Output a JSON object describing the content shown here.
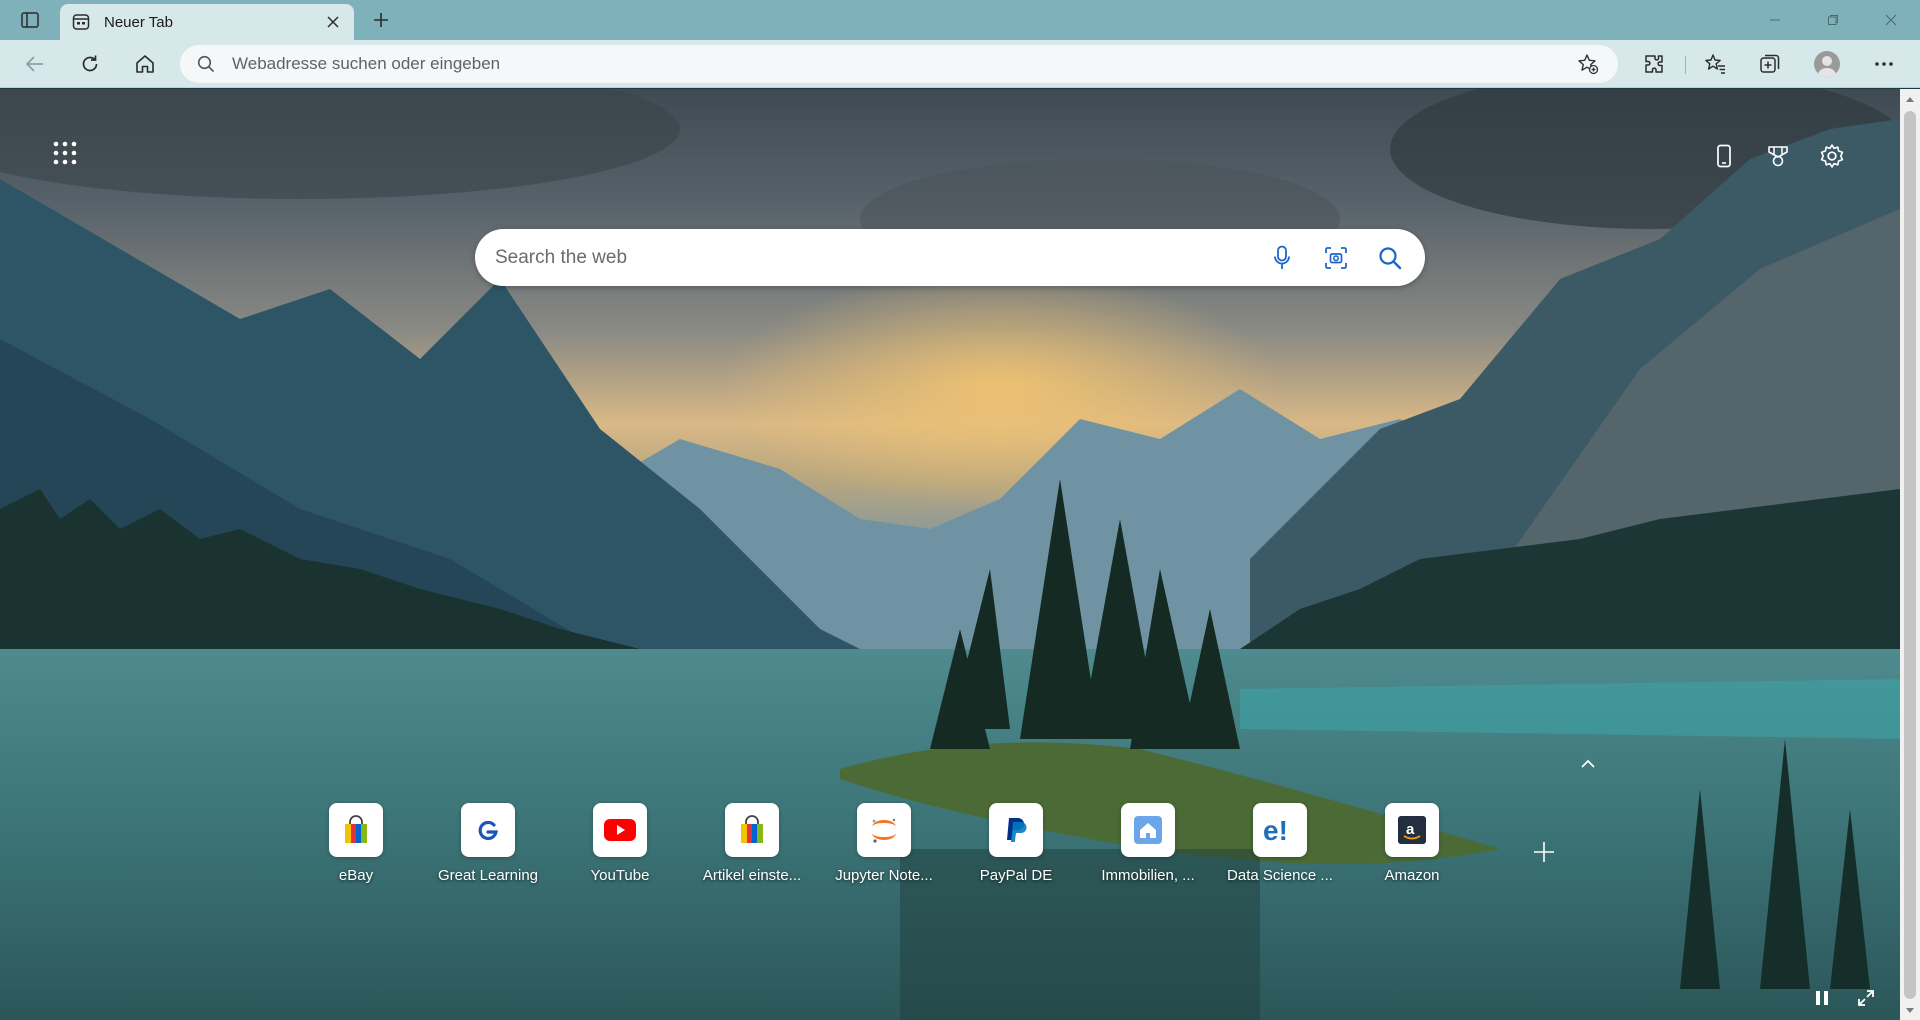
{
  "browser": {
    "tab": {
      "title": "Neuer Tab",
      "icon": "new-tab-page-icon"
    },
    "window_controls": [
      "minimize-icon",
      "restore-icon",
      "close-icon"
    ],
    "toolbar": {
      "address_placeholder": "Webadresse suchen oder eingeben",
      "buttons": [
        "back-icon",
        "refresh-icon",
        "home-icon",
        "favorite-add-icon",
        "extensions-icon",
        "favorites-icon",
        "collections-icon",
        "profile-avatar",
        "more-icon"
      ]
    }
  },
  "ntp": {
    "search": {
      "placeholder": "Search the web",
      "icons": [
        "microphone-icon",
        "visual-search-icon",
        "search-icon"
      ]
    },
    "top_right_icons": [
      "phone-icon",
      "rewards-icon",
      "settings-icon"
    ],
    "quick_links": [
      {
        "label": "eBay",
        "icon": "shopping-bag-icon"
      },
      {
        "label": "Great Learning",
        "icon": "g-logo-icon"
      },
      {
        "label": "YouTube",
        "icon": "youtube-icon"
      },
      {
        "label": "Artikel einste...",
        "icon": "shopping-bag-icon"
      },
      {
        "label": "Jupyter Note...",
        "icon": "jupyter-icon"
      },
      {
        "label": "PayPal DE",
        "icon": "paypal-icon"
      },
      {
        "label": "Immobilien, ...",
        "icon": "house-icon"
      },
      {
        "label": "Data Science ...",
        "icon": "e-logo-icon"
      },
      {
        "label": "Amazon",
        "icon": "amazon-icon"
      }
    ],
    "bottom_controls": [
      "pause-icon",
      "expand-icon"
    ]
  },
  "colors": {
    "titlebar": "#7fb1bb",
    "toolbar": "#d7e8eb",
    "accent_youtube": "#ff0000",
    "accent_paypal": "#003087"
  }
}
